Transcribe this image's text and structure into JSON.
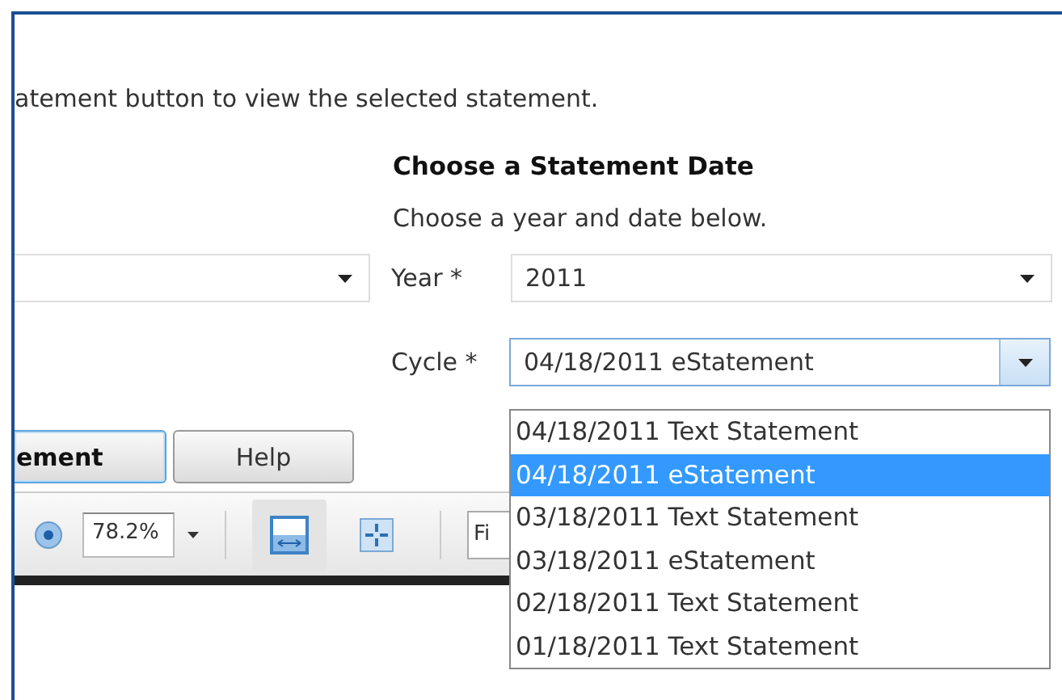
{
  "instruction": "atement button to view the selected statement.",
  "section": {
    "title": "Choose a Statement Date",
    "subtitle": "Choose a year and date below."
  },
  "year": {
    "label": "Year *",
    "value": "2011"
  },
  "cycle": {
    "label": "Cycle *",
    "value": "04/18/2011 eStatement",
    "expanded": true,
    "options": [
      {
        "label": "04/18/2011 Text Statement",
        "selected": false
      },
      {
        "label": "04/18/2011 eStatement",
        "selected": true
      },
      {
        "label": "03/18/2011 Text Statement",
        "selected": false
      },
      {
        "label": "03/18/2011 eStatement",
        "selected": false
      },
      {
        "label": "02/18/2011 Text Statement",
        "selected": false
      },
      {
        "label": "01/18/2011 Text Statement",
        "selected": false
      }
    ]
  },
  "buttons": [
    {
      "label": "ement",
      "focused": true
    },
    {
      "label": "Help",
      "focused": false
    }
  ],
  "toolbar": {
    "zoom": "78.2%",
    "find": "Fi"
  }
}
